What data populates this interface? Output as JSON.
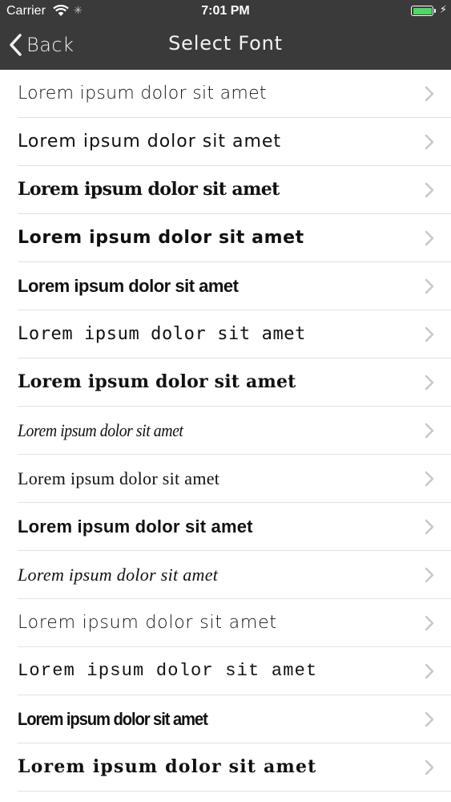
{
  "status_bar": {
    "carrier": "Carrier",
    "time": "7:01 PM",
    "battery_color": "#4cd964",
    "icons": [
      "wifi-icon",
      "activity-icon",
      "battery-icon",
      "charging-bolt-icon"
    ]
  },
  "navbar": {
    "back_label": "Back",
    "title": "Select Font",
    "background": "#3a3a3a"
  },
  "fonts": [
    {
      "label": "Lorem ipsum dolor sit amet"
    },
    {
      "label": "Lorem ipsum dolor sit amet"
    },
    {
      "label": "Lorem ipsum dolor sit amet"
    },
    {
      "label": "Lorem ipsum dolor sit amet"
    },
    {
      "label": "Lorem ipsum dolor sit amet"
    },
    {
      "label": "Lorem ipsum dolor sit amet"
    },
    {
      "label": "Lorem ipsum dolor sit amet"
    },
    {
      "label": "Lorem ipsum dolor sit amet"
    },
    {
      "label": "Lorem ipsum dolor sit amet"
    },
    {
      "label": "Lorem ipsum dolor sit amet"
    },
    {
      "label": "Lorem ipsum dolor sit amet"
    },
    {
      "label": "Lorem ipsum dolor sit amet"
    },
    {
      "label": "Lorem ipsum dolor sit amet"
    },
    {
      "label": "Lorem ipsum dolor sit amet"
    },
    {
      "label": "Lorem ipsum dolor sit amet"
    }
  ]
}
